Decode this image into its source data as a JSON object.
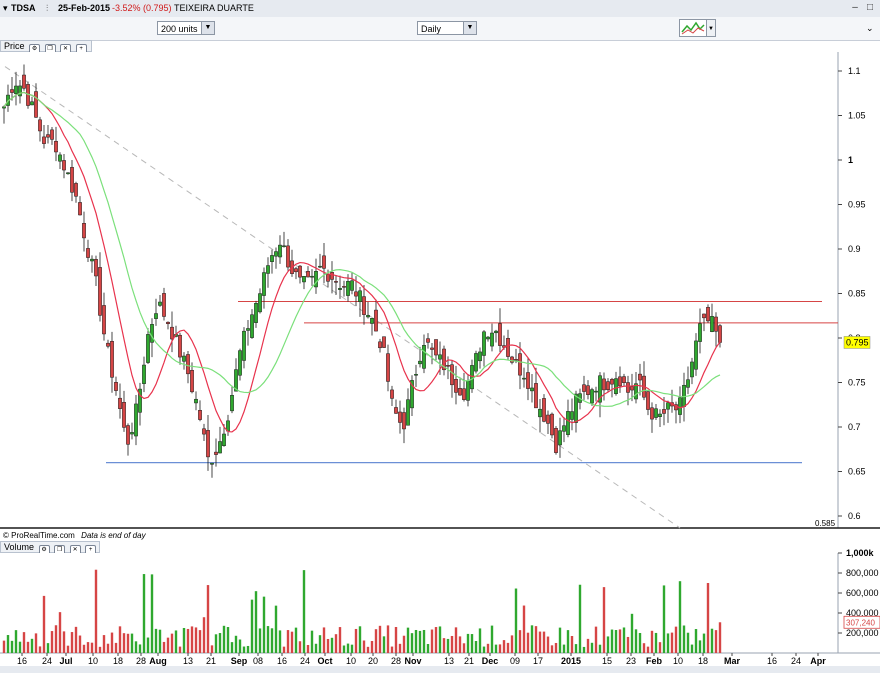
{
  "titlebar": {
    "symbol": "TDSA",
    "date": "25-Feb-2015",
    "change": "-3.52% (0.795)",
    "name": "TEIXEIRA DUARTE"
  },
  "toolbar": {
    "units": "200 units",
    "period": "Daily"
  },
  "price_panel": {
    "label": "Price",
    "last_price": "0.795",
    "low_marker": "0.585",
    "footer": "© ProRealTime.com",
    "footer_note": "Data is end of day"
  },
  "volume_panel": {
    "label": "Volume",
    "last_volume": "307,240"
  },
  "x_axis": [
    {
      "label": "16"
    },
    {
      "label": "24"
    },
    {
      "label": "Jul",
      "bold": true
    },
    {
      "label": "10"
    },
    {
      "label": "18"
    },
    {
      "label": "28"
    },
    {
      "label": "Aug",
      "bold": true
    },
    {
      "label": "13"
    },
    {
      "label": "21"
    },
    {
      "label": "Sep",
      "bold": true
    },
    {
      "label": "08"
    },
    {
      "label": "16"
    },
    {
      "label": "24"
    },
    {
      "label": "Oct",
      "bold": true
    },
    {
      "label": "10"
    },
    {
      "label": "20"
    },
    {
      "label": "28"
    },
    {
      "label": "Nov",
      "bold": true
    },
    {
      "label": "13"
    },
    {
      "label": "21"
    },
    {
      "label": "Dec",
      "bold": true
    },
    {
      "label": "09"
    },
    {
      "label": "17"
    },
    {
      "label": "2015",
      "bold": true
    },
    {
      "label": "15"
    },
    {
      "label": "23"
    },
    {
      "label": "Feb",
      "bold": true
    },
    {
      "label": "10"
    },
    {
      "label": "18"
    },
    {
      "label": "Mar",
      "bold": true
    },
    {
      "label": "16"
    },
    {
      "label": "24"
    },
    {
      "label": "Apr",
      "bold": true
    }
  ],
  "chart_data": [
    {
      "type": "candlestick",
      "title": "TDSA - TEIXEIRA DUARTE",
      "y_ticks": [
        "1.1",
        "1.05",
        "1",
        "0.95",
        "0.9",
        "0.85",
        "0.8",
        "0.75",
        "0.7",
        "0.65",
        "0.6"
      ],
      "ylim": [
        0.583,
        1.117
      ],
      "last_price": 0.795,
      "support_line": 0.66,
      "resistance_lines": [
        0.841,
        0.817
      ],
      "close_series_approx": [
        1.06,
        1.09,
        1.08,
        1.05,
        1.02,
        1.02,
        0.99,
        0.96,
        0.91,
        0.86,
        0.79,
        0.74,
        0.68,
        0.72,
        0.8,
        0.84,
        0.82,
        0.79,
        0.76,
        0.72,
        0.66,
        0.68,
        0.72,
        0.78,
        0.82,
        0.85,
        0.89,
        0.91,
        0.88,
        0.86,
        0.86,
        0.88,
        0.87,
        0.86,
        0.86,
        0.84,
        0.82,
        0.79,
        0.72,
        0.7,
        0.75,
        0.8,
        0.78,
        0.77,
        0.75,
        0.74,
        0.77,
        0.81,
        0.81,
        0.79,
        0.77,
        0.76,
        0.73,
        0.71,
        0.68,
        0.71,
        0.73,
        0.74,
        0.75,
        0.75,
        0.76,
        0.74,
        0.75,
        0.72,
        0.71,
        0.72,
        0.72,
        0.76,
        0.81,
        0.82,
        0.795
      ]
    },
    {
      "type": "bar",
      "title": "Volume",
      "y_ticks": [
        "1,000k",
        "800,000",
        "600,000",
        "400,000",
        "200,000"
      ],
      "ylim": [
        0,
        1000000
      ],
      "last_value": 307240
    }
  ],
  "colors": {
    "up": "#2fa82f",
    "down": "#d64545",
    "ma_fast": "#e8334d",
    "ma_slow": "#7be07b",
    "support": "#6b8fd6",
    "resistance": "#d64545",
    "highlight": "#ffff00"
  }
}
